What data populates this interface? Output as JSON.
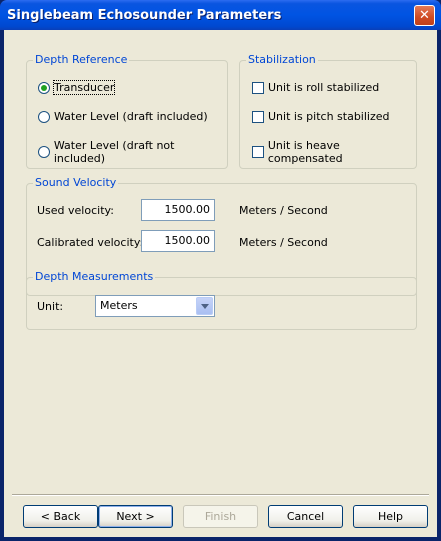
{
  "window": {
    "title": "Singlebeam Echosounder Parameters",
    "close_glyph": "✕"
  },
  "depth_reference": {
    "legend": "Depth Reference",
    "options": [
      {
        "label": "Transducer",
        "checked": true
      },
      {
        "label": "Water Level (draft included)",
        "checked": false
      },
      {
        "label": "Water Level (draft not included)",
        "checked": false
      }
    ]
  },
  "stabilization": {
    "legend": "Stabilization",
    "options": [
      {
        "label": "Unit is roll stabilized",
        "checked": false
      },
      {
        "label": "Unit is pitch stabilized",
        "checked": false
      },
      {
        "label": "Unit is heave compensated",
        "checked": false
      }
    ]
  },
  "sound_velocity": {
    "legend": "Sound Velocity",
    "used_label": "Used velocity:",
    "used_value": "1500.00",
    "used_unit": "Meters / Second",
    "calibrated_label": "Calibrated velocity:",
    "calibrated_value": "1500.00",
    "calibrated_unit": "Meters / Second"
  },
  "depth_measurements": {
    "legend": "Depth Measurements",
    "unit_label": "Unit:",
    "unit_value": "Meters"
  },
  "buttons": {
    "back": "< Back",
    "next": "Next >",
    "finish": "Finish",
    "cancel": "Cancel",
    "help": "Help"
  }
}
